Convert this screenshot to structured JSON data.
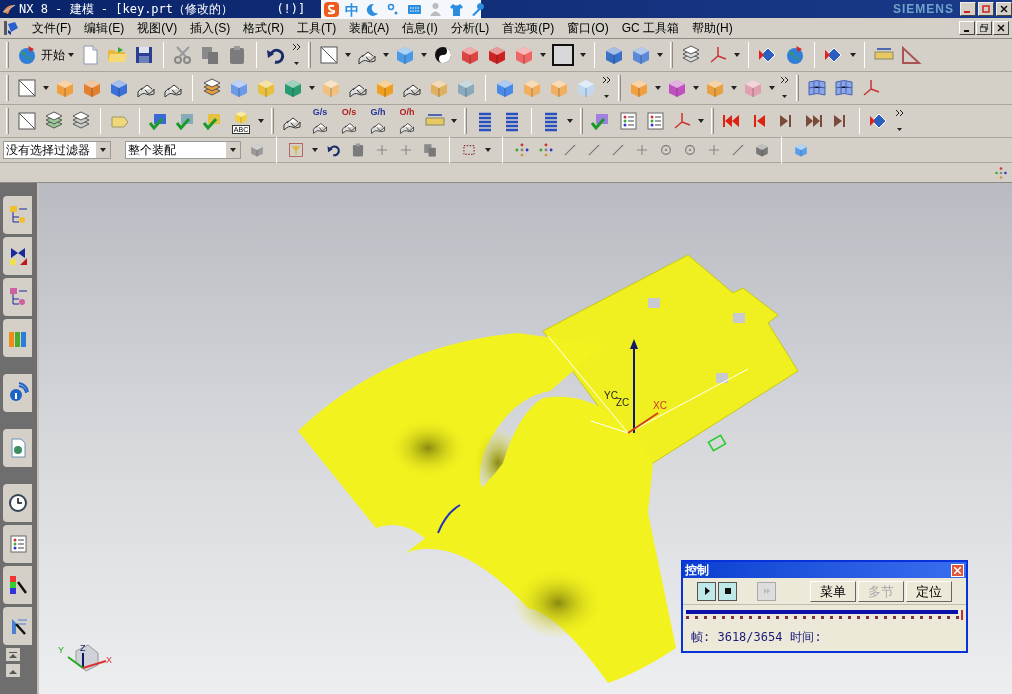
{
  "window": {
    "title": "NX 8 - 建模 - [key.prt（修改的）      (!)]",
    "brand": "SIEMENS"
  },
  "ime_bar": {
    "mode": "中"
  },
  "menu": [
    "文件(F)",
    "编辑(E)",
    "视图(V)",
    "插入(S)",
    "格式(R)",
    "工具(T)",
    "装配(A)",
    "信息(I)",
    "分析(L)",
    "首选项(P)",
    "窗口(O)",
    "GC 工具箱",
    "帮助(H)"
  ],
  "toolbar": {
    "start_button": "开始",
    "icon_labels": [
      "ABC",
      "G/s",
      "O/s",
      "G/h",
      "O/h"
    ]
  },
  "selection_bar": {
    "filter": "没有选择过滤器",
    "scope": "整个装配"
  },
  "viewport": {
    "axis_labels": [
      "YC",
      "ZC",
      "XC"
    ],
    "triad_labels": [
      "Y",
      "Z",
      "X"
    ]
  },
  "control_dialog": {
    "title": "控制",
    "buttons": [
      {
        "label": "菜单",
        "disabled": false
      },
      {
        "label": "多节",
        "disabled": true
      },
      {
        "label": "定位",
        "disabled": false
      }
    ],
    "level": 0.99,
    "frame": "帧: 3618/3654",
    "time": "时间:"
  }
}
